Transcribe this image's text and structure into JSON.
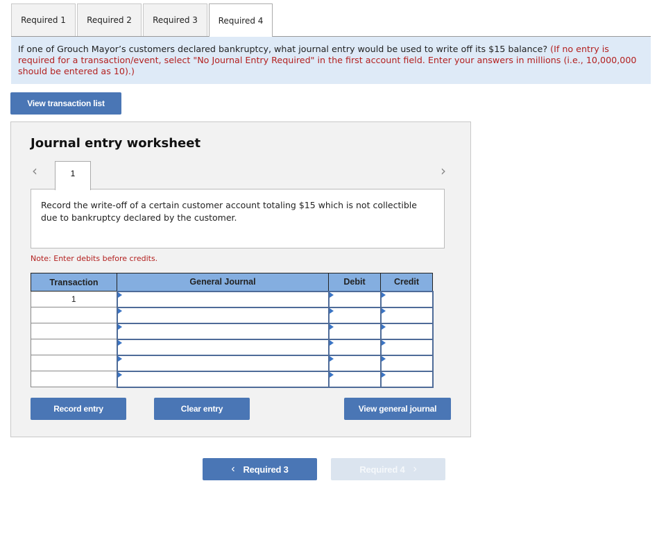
{
  "tabs": [
    {
      "label": "Required 1",
      "active": false
    },
    {
      "label": "Required 2",
      "active": false
    },
    {
      "label": "Required 3",
      "active": false
    },
    {
      "label": "Required 4",
      "active": true
    }
  ],
  "question": {
    "text": "If one of Grouch Mayor’s customers declared bankruptcy, what journal entry would be used to write off its $15 balance?",
    "instruction": "(If no entry is required for a transaction/event, select \"No Journal Entry Required\" in the first account field. Enter your answers in millions (i.e., 10,000,000 should be entered as 10).)"
  },
  "view_transaction_list_label": "View transaction list",
  "worksheet": {
    "title": "Journal entry worksheet",
    "current_entry_tab": "1",
    "description": "Record the write-off of a certain customer account totaling $15 which is not collectible due to bankruptcy declared by the customer.",
    "note": "Note: Enter debits before credits.",
    "table": {
      "headers": [
        "Transaction",
        "General Journal",
        "Debit",
        "Credit"
      ],
      "rows": [
        {
          "transaction": "1",
          "account": "",
          "debit": "",
          "credit": ""
        },
        {
          "transaction": "",
          "account": "",
          "debit": "",
          "credit": ""
        },
        {
          "transaction": "",
          "account": "",
          "debit": "",
          "credit": ""
        },
        {
          "transaction": "",
          "account": "",
          "debit": "",
          "credit": ""
        },
        {
          "transaction": "",
          "account": "",
          "debit": "",
          "credit": ""
        },
        {
          "transaction": "",
          "account": "",
          "debit": "",
          "credit": ""
        }
      ]
    },
    "buttons": {
      "record": "Record entry",
      "clear": "Clear entry",
      "view_journal": "View general journal"
    }
  },
  "footer_nav": {
    "prev_label": "Required 3",
    "next_label": "Required 4",
    "prev_icon": "‹",
    "next_icon": "›"
  },
  "icons": {
    "chevron_left": "‹",
    "chevron_right": "›"
  }
}
